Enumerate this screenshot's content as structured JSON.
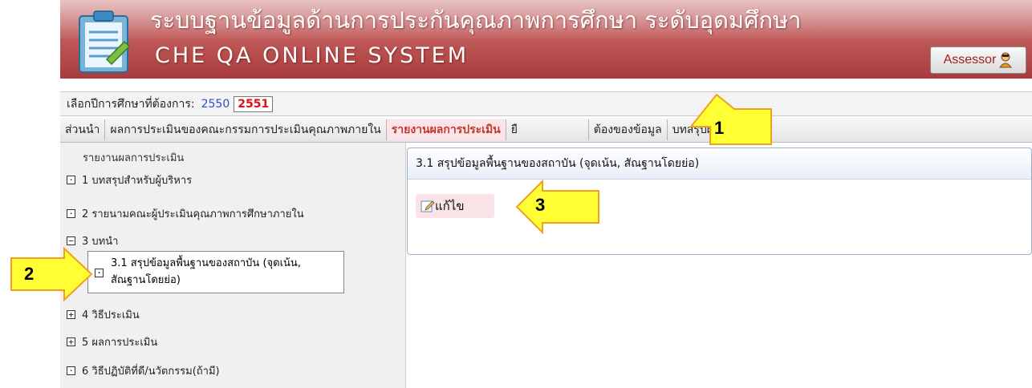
{
  "header": {
    "title_th": "ระบบฐานข้อมูลด้านการประกันคุณภาพการศึกษา ระดับอุดมศึกษา",
    "title_en": "CHE QA ONLINE SYSTEM",
    "role_button": "Assessor",
    "brand_color": "#b84a4a"
  },
  "year_selector": {
    "label": "เลือกปีการศึกษาที่ต้องการ:",
    "years": [
      "2550",
      "2551"
    ],
    "selected": "2551"
  },
  "tabs": [
    {
      "label": "ส่วนนำ",
      "active": false
    },
    {
      "label": "ผลการประเมินของคณะกรรมการประเมินคุณภาพภายใน",
      "active": false
    },
    {
      "label": "รายงานผลการประเมิน",
      "active": true
    },
    {
      "label": "ยื",
      "active": false
    },
    {
      "label": "ต้องของข้อมูล",
      "active": false
    },
    {
      "label": "บทสรุปผู้บริหาร",
      "active": false
    }
  ],
  "sidebar": {
    "title": "รายงานผลการประเมิน",
    "items": [
      {
        "label": "1 บทสรุปสำหรับผู้บริหาร",
        "toggle": "·"
      },
      {
        "label": "2 รายนามคณะผู้ประเมินคุณภาพการศึกษาภายใน",
        "toggle": "·"
      },
      {
        "label": "3 บทนำ",
        "toggle": "−"
      },
      {
        "label": "3.1 สรุปข้อมูลพื้นฐานของสถาบัน (จุดเน้น, สัณฐานโดยย่อ)",
        "toggle": "·",
        "selected": true
      },
      {
        "label": "4 วิธีประเมิน",
        "toggle": "+"
      },
      {
        "label": "5 ผลการประเมิน",
        "toggle": "+"
      },
      {
        "label": "6 วิธีปฏิบัติที่ดี/นวัตกรรม(ถ้ามี)",
        "toggle": "·"
      }
    ]
  },
  "main": {
    "panel_title": "3.1 สรุปข้อมูลพื้นฐานของสถาบัน (จุดเน้น, สัณฐานโดยย่อ)",
    "edit_label": "แก้ไข"
  },
  "callouts": [
    "1",
    "2",
    "3"
  ],
  "colors": {
    "active_tab_text": "#c0392b",
    "callout_fill": "#ffff33",
    "callout_stroke": "#f0a020"
  }
}
